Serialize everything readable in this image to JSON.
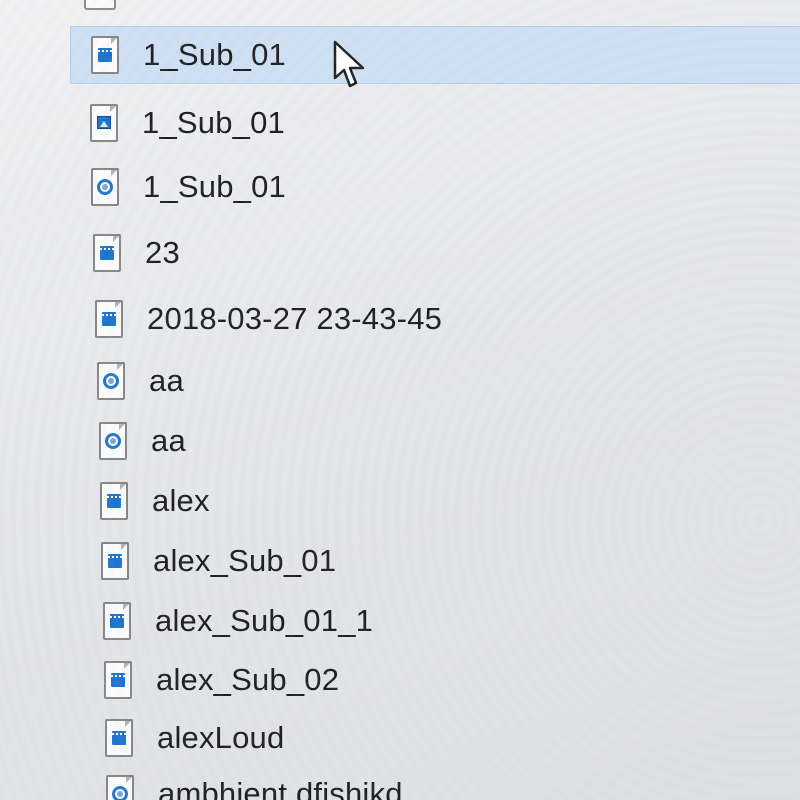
{
  "file_list": {
    "items": [
      {
        "name": "1_Sub_01",
        "icon": "video-file-icon",
        "selected": true
      },
      {
        "name": "1_Sub_01",
        "icon": "image-file-icon",
        "selected": false
      },
      {
        "name": "1_Sub_01",
        "icon": "audio-file-icon",
        "selected": false
      },
      {
        "name": "23",
        "icon": "video-file-icon",
        "selected": false
      },
      {
        "name": "2018-03-27 23-43-45",
        "icon": "video-file-icon",
        "selected": false
      },
      {
        "name": "aa",
        "icon": "audio-file-icon",
        "selected": false
      },
      {
        "name": "aa",
        "icon": "audio-file-icon",
        "selected": false
      },
      {
        "name": "alex",
        "icon": "video-file-icon",
        "selected": false
      },
      {
        "name": "alex_Sub_01",
        "icon": "video-file-icon",
        "selected": false
      },
      {
        "name": "alex_Sub_01_1",
        "icon": "video-file-icon",
        "selected": false
      },
      {
        "name": "alex_Sub_02",
        "icon": "video-file-icon",
        "selected": false
      },
      {
        "name": "alexLoud",
        "icon": "video-file-icon",
        "selected": false
      },
      {
        "name": "ambhient dfishikd",
        "icon": "audio-file-icon",
        "selected": false
      }
    ]
  },
  "colors": {
    "selection_background": "#cfe0f3",
    "selection_border": "#b4cde8",
    "video_icon_blue": "#1d74cf",
    "audio_icon_blue": "#2478cc"
  },
  "cursor": {
    "icon": "mouse-pointer-icon"
  }
}
